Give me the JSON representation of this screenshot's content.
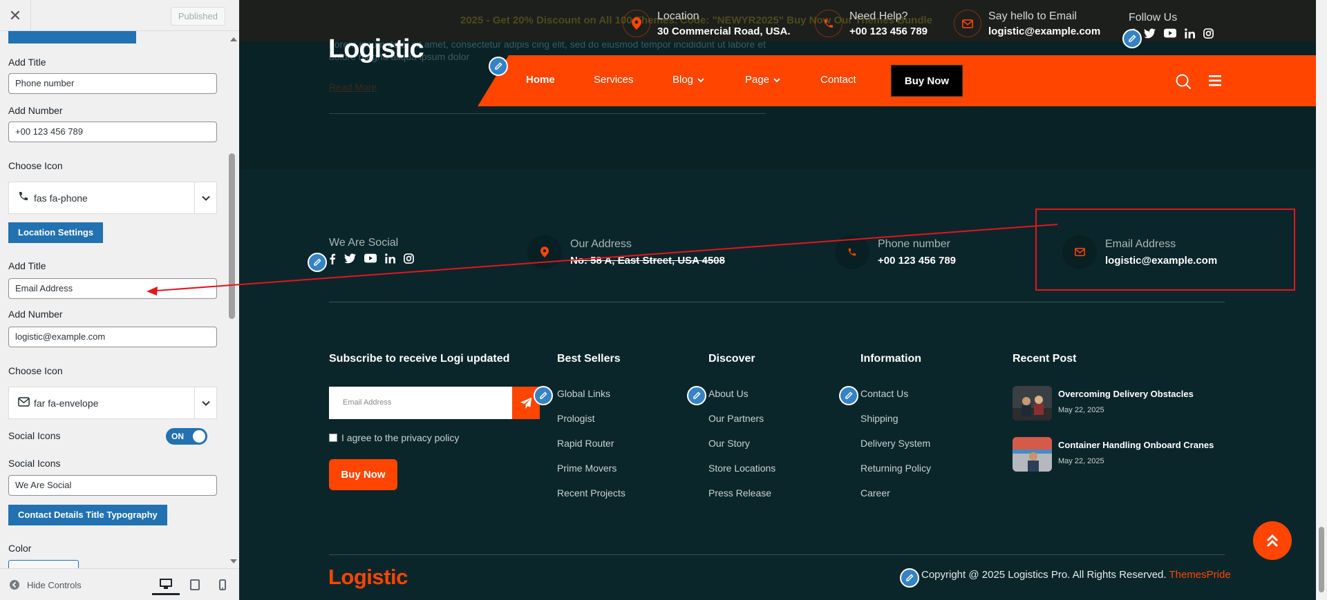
{
  "panel": {
    "close_icon": "close-icon",
    "published_label": "Published",
    "add_title_label": "Add Title",
    "add_number_label": "Add Number",
    "choose_icon_label": "Choose Icon",
    "phone": {
      "title_value": "Phone number",
      "number_value": "+00 123 456 789",
      "icon_value": "fas fa-phone"
    },
    "location_settings_button": "Location Settings",
    "email": {
      "title_value": "Email Address",
      "number_value": "logistic@example.com",
      "icon_value": "far fa-envelope"
    },
    "social_icons_label": "Social Icons",
    "toggle_label": "ON",
    "social_icons_value": "We Are Social",
    "typography_button": "Contact Details Title Typography",
    "color_label": "Color",
    "hide_controls": "Hide Controls"
  },
  "preview": {
    "promo_text": "2025 - Get 20% Discount on All 100 Themes. Code: \"NEWYR2025\" Buy Now Our Themes Bundle",
    "header": {
      "location_title": "Location",
      "location_value": "30 Commercial Road, USA.",
      "help_title": "Need Help?",
      "help_value": "+00 123 456 789",
      "email_title": "Say hello to Email",
      "email_value": "logistic@example.com",
      "follow_title": "Follow Us"
    },
    "logo": "Logistic",
    "hero_text": "Lorem ipsum dolor sit amet, consectetur adipis cing elit, sed do eiusmod tempor incididunt ut labore et dolore magna aliqua ipsum dolor",
    "read_more": "Read More",
    "nav": [
      "Home",
      "Services",
      "Blog",
      "Page",
      "Contact"
    ],
    "nav_buy": "Buy Now",
    "contact": {
      "social_title": "We Are Social",
      "address_title": "Our Address",
      "address_value": "No: 58 A, East Street, USA 4508",
      "phone_title": "Phone number",
      "phone_value": "+00 123 456 789",
      "email_title": "Email Address",
      "email_value": "logistic@example.com"
    },
    "subscribe_title": "Subscribe to receive Logi updated",
    "email_placeholder": "Email Address",
    "agree_text": "I agree to the privacy policy",
    "footer_buy": "Buy Now",
    "columns": {
      "best_sellers": {
        "title": "Best Sellers",
        "links": [
          "Global Links",
          "Prologist",
          "Rapid Router",
          "Prime Movers",
          "Recent Projects"
        ]
      },
      "discover": {
        "title": "Discover",
        "links": [
          "About Us",
          "Our Partners",
          "Our Story",
          "Store Locations",
          "Press Release"
        ]
      },
      "information": {
        "title": "Information",
        "links": [
          "Contact Us",
          "Shipping",
          "Delivery System",
          "Returning Policy",
          "Career"
        ]
      }
    },
    "recent_post": {
      "title": "Recent Post",
      "posts": [
        {
          "title": "Overcoming Delivery Obstacles",
          "date": "May 22, 2025"
        },
        {
          "title": "Container Handling Onboard Cranes",
          "date": "May 22, 2025"
        }
      ]
    },
    "footer_logo": "Logistic",
    "copyright": "Copyright @ 2025 Logistics Pro. All Rights Reserved.",
    "copyright_brand": "ThemesPride"
  },
  "colors": {
    "brand": "#ff4500",
    "dark_bg": "#0b262b",
    "wp_blue": "#2271b1",
    "annotation_red": "#e3161c"
  }
}
